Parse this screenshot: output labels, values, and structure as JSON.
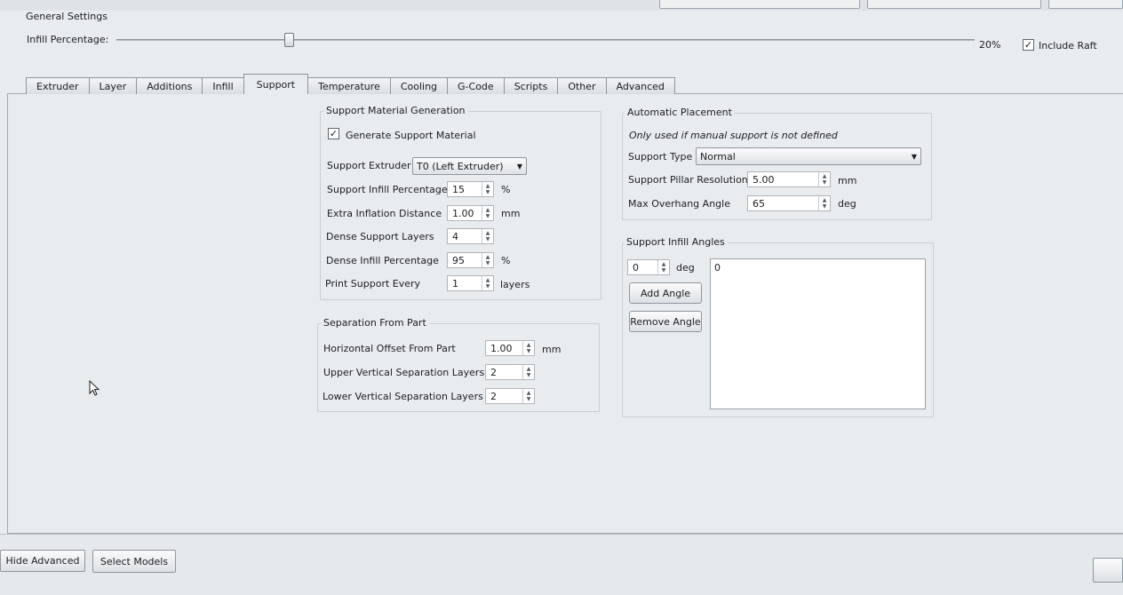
{
  "general": {
    "title": "General Settings",
    "infill_label": "Infill Percentage:",
    "infill_value": "20%",
    "infill_fraction": 0.2,
    "include_raft_label": "Include Raft",
    "include_raft_checked": true
  },
  "tabs": [
    {
      "label": "Extruder",
      "active": false
    },
    {
      "label": "Layer",
      "active": false
    },
    {
      "label": "Additions",
      "active": false
    },
    {
      "label": "Infill",
      "active": false
    },
    {
      "label": "Support",
      "active": true
    },
    {
      "label": "Temperature",
      "active": false
    },
    {
      "label": "Cooling",
      "active": false
    },
    {
      "label": "G-Code",
      "active": false
    },
    {
      "label": "Scripts",
      "active": false
    },
    {
      "label": "Other",
      "active": false
    },
    {
      "label": "Advanced",
      "active": false
    }
  ],
  "support_material": {
    "title": "Support Material Generation",
    "generate_label": "Generate Support Material",
    "generate_checked": true,
    "extruder_label": "Support Extruder",
    "extruder_value": "T0 (Left Extruder)",
    "infill_pct_label": "Support Infill Percentage",
    "infill_pct_value": "15",
    "infill_pct_unit": "%",
    "inflation_label": "Extra Inflation Distance",
    "inflation_value": "1.00",
    "inflation_unit": "mm",
    "dense_layers_label": "Dense Support Layers",
    "dense_layers_value": "4",
    "dense_infill_label": "Dense Infill Percentage",
    "dense_infill_value": "95",
    "dense_infill_unit": "%",
    "print_every_label": "Print Support Every",
    "print_every_value": "1",
    "print_every_unit": "layers"
  },
  "separation": {
    "title": "Separation From Part",
    "h_offset_label": "Horizontal Offset From Part",
    "h_offset_value": "1.00",
    "h_offset_unit": "mm",
    "upper_label": "Upper Vertical Separation Layers",
    "upper_value": "2",
    "lower_label": "Lower Vertical Separation Layers",
    "lower_value": "2"
  },
  "auto_placement": {
    "title": "Automatic Placement",
    "note": "Only used if manual support is not defined",
    "type_label": "Support Type",
    "type_value": "Normal",
    "pillar_label": "Support Pillar Resolution",
    "pillar_value": "5.00",
    "pillar_unit": "mm",
    "overhang_label": "Max Overhang Angle",
    "overhang_value": "65",
    "overhang_unit": "deg"
  },
  "infill_angles": {
    "title": "Support Infill Angles",
    "angle_value": "0",
    "angle_unit": "deg",
    "add_label": "Add Angle",
    "remove_label": "Remove Angle",
    "list": [
      "0"
    ]
  },
  "bottom": {
    "hide_advanced_label": "Hide Advanced",
    "select_models_label": "Select Models"
  }
}
